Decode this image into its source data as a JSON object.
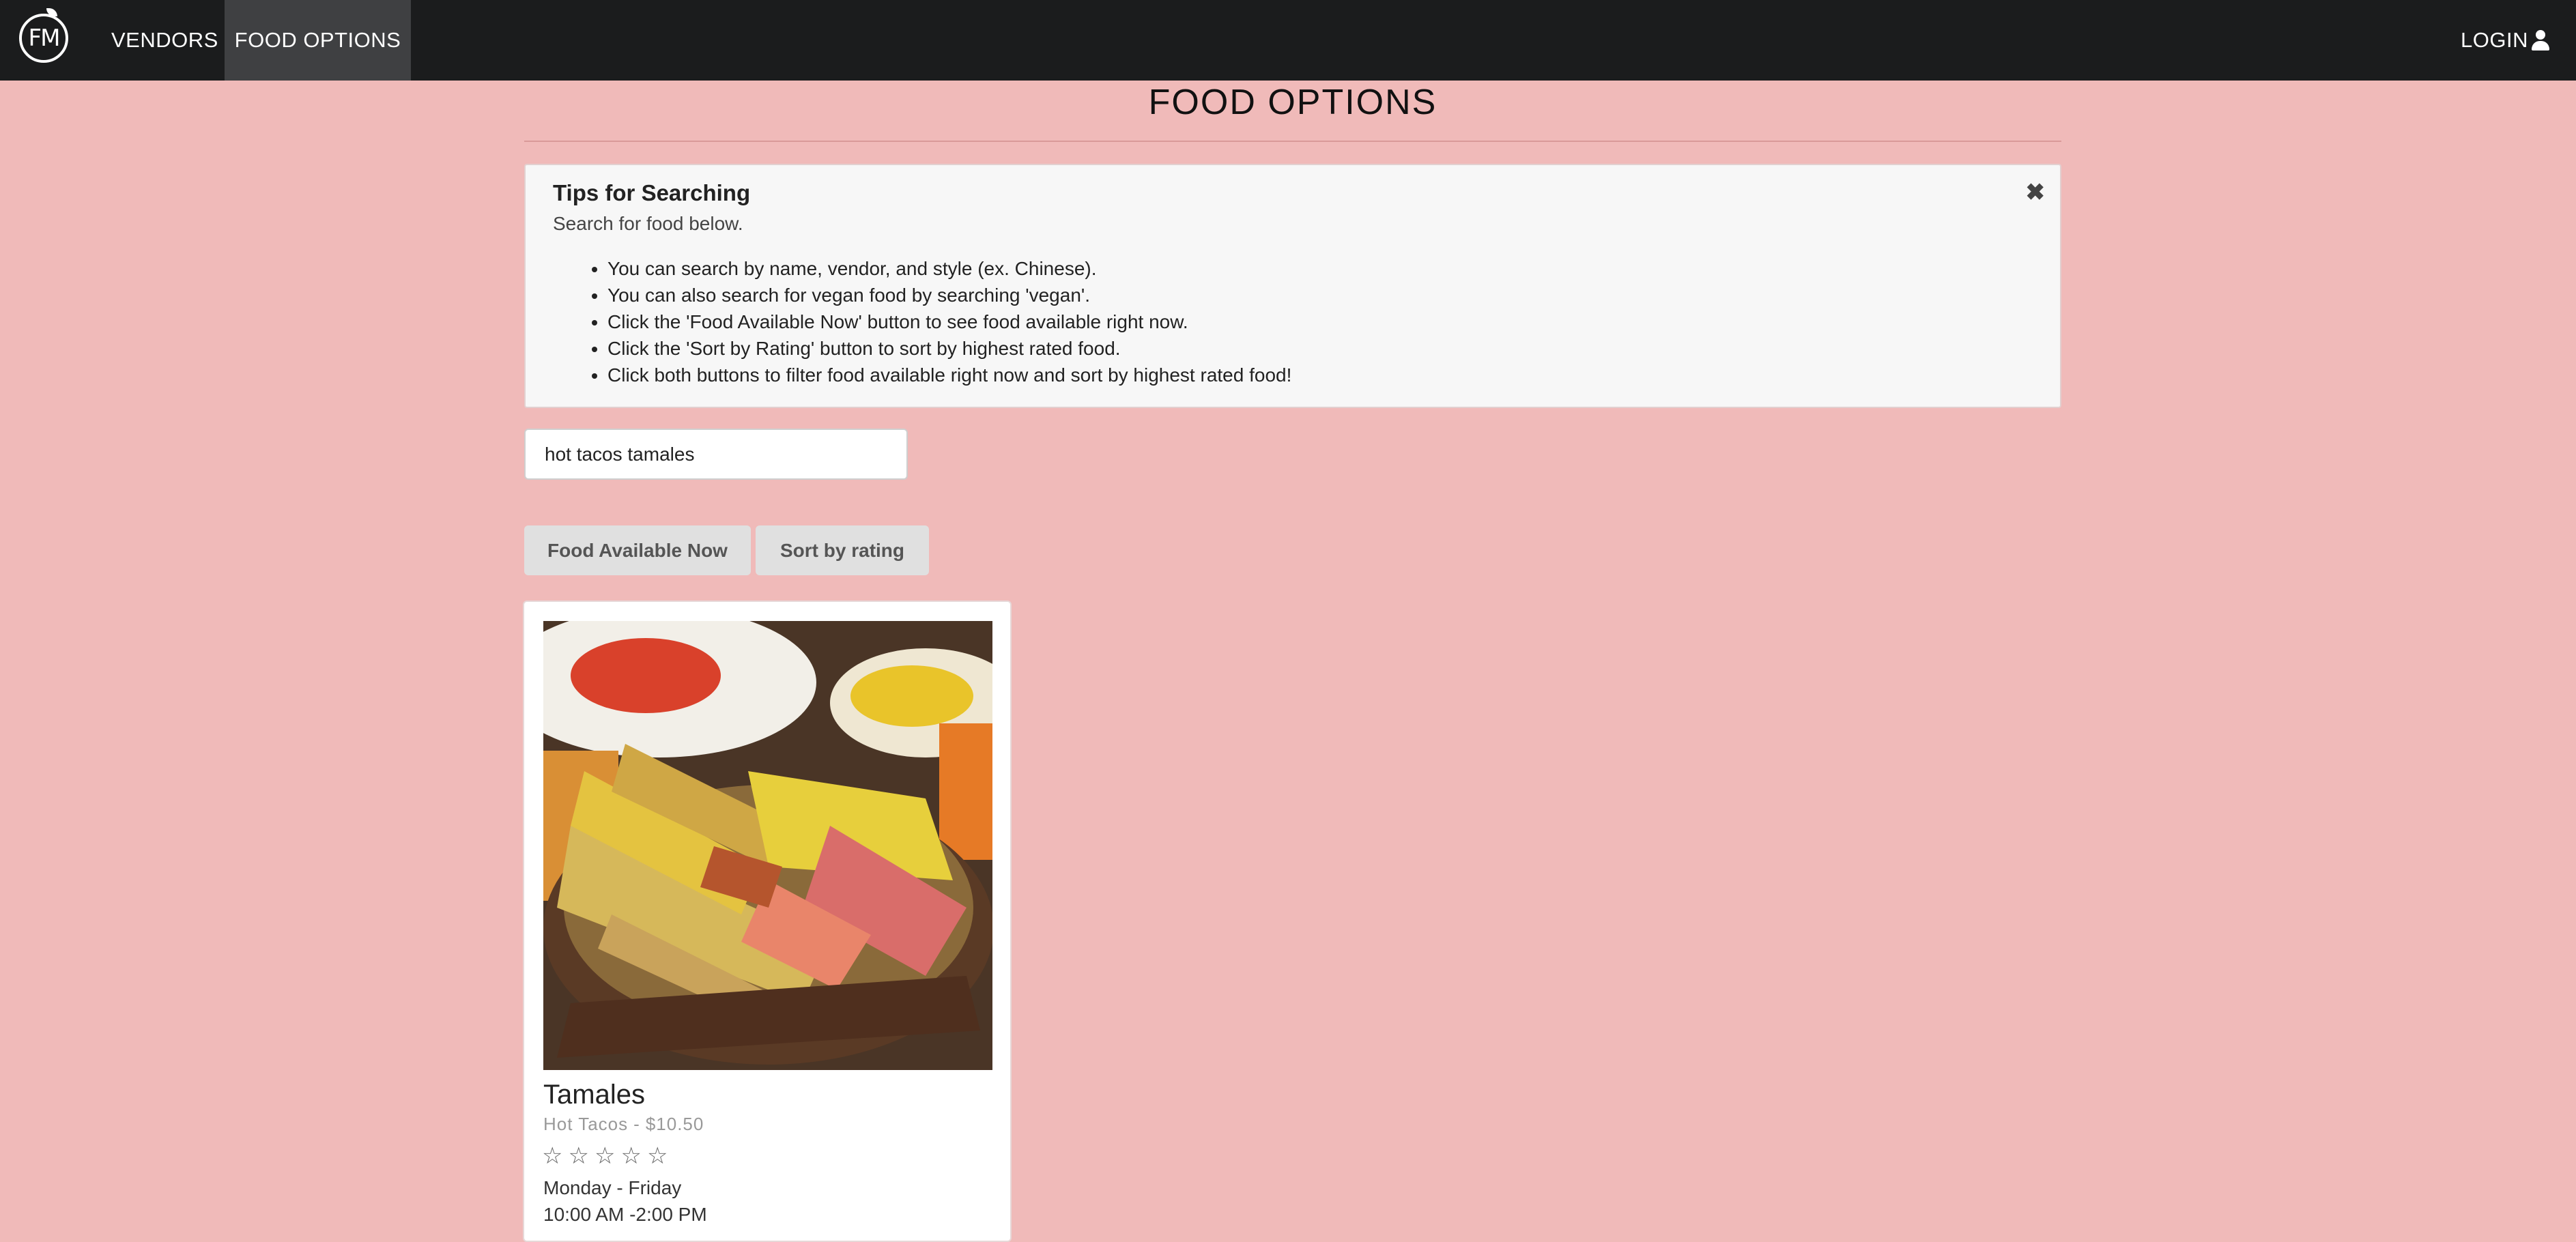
{
  "nav": {
    "logo_text": "FM",
    "vendors_label": "VENDORS",
    "food_options_label": "FOOD OPTIONS",
    "login_label": "LOGIN"
  },
  "page": {
    "title": "FOOD OPTIONS"
  },
  "tips": {
    "title": "Tips for Searching",
    "subtitle": "Search for food below.",
    "close_glyph": "✖",
    "items": [
      "You can search by name, vendor, and style (ex. Chinese).",
      "You can also search for vegan food by searching 'vegan'.",
      "Click the 'Food Available Now' button to see food available right now.",
      "Click the 'Sort by Rating' button to sort by highest rated food.",
      "Click both buttons to filter food available right now and sort by highest rated food!"
    ]
  },
  "search": {
    "value": "hot tacos tamales"
  },
  "buttons": {
    "available_now": "Food Available Now",
    "sort_rating": "Sort by rating"
  },
  "results": [
    {
      "name": "Tamales",
      "vendor": "Hot Tacos",
      "price": "$10.50",
      "rating": 0,
      "max_rating": 5,
      "days": "Monday - Friday",
      "hours": "10:00 AM -2:00 PM"
    }
  ],
  "colors": {
    "background": "#f0bab9",
    "navbar": "#1b1c1d",
    "active_nav": "#3f4042"
  }
}
